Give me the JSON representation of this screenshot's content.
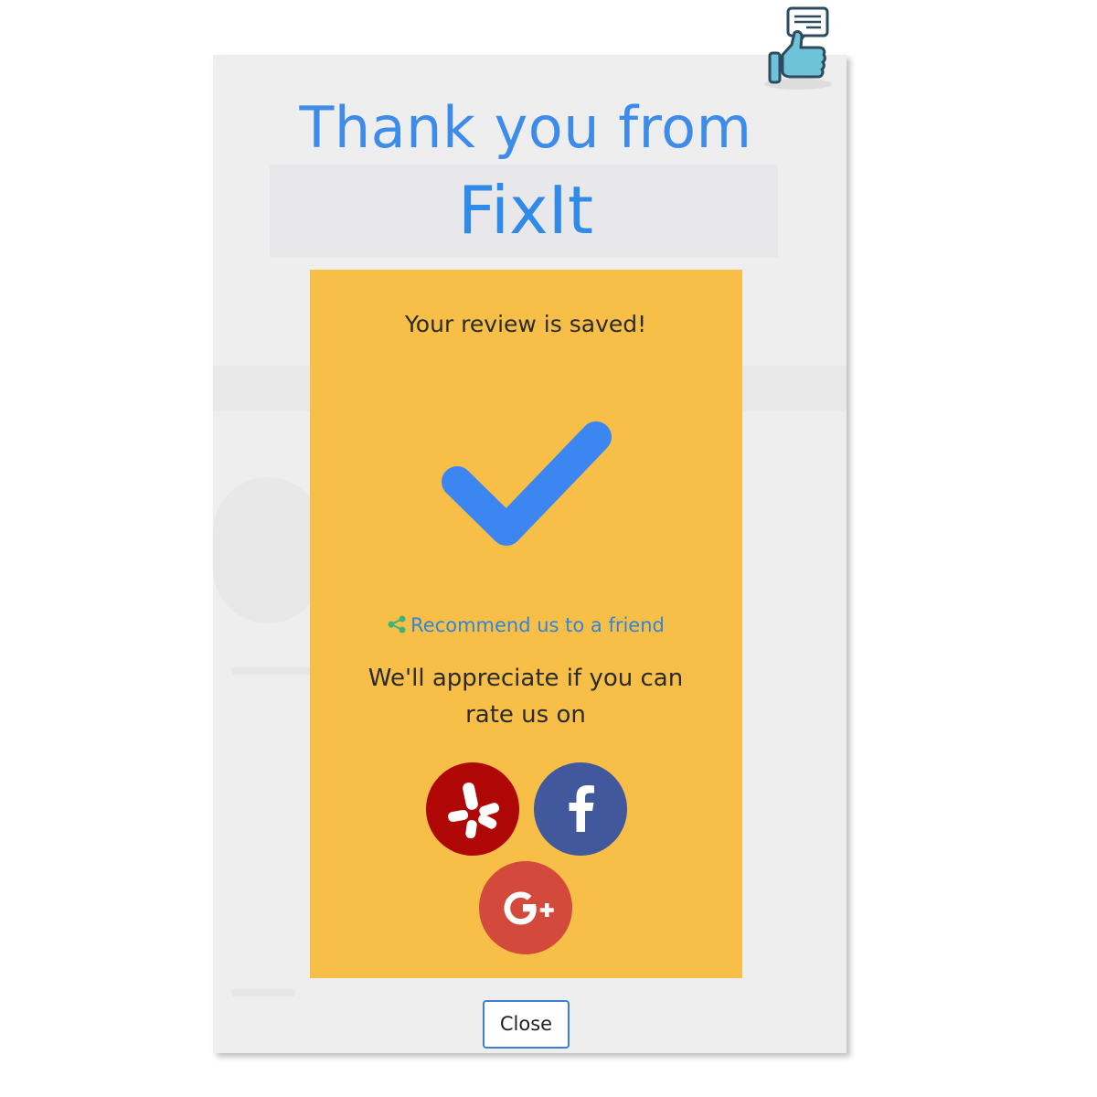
{
  "header": {
    "title_line_1": "Thank you from",
    "title_line_2": "FixIt"
  },
  "review_card": {
    "saved_message": "Your review is saved!",
    "recommend_link": "Recommend us to a friend",
    "appreciate_message": "We'll appreciate if you can rate us on",
    "social_buttons": [
      {
        "name": "yelp",
        "icon": "yelp-icon",
        "color": "#af0606"
      },
      {
        "name": "facebook",
        "icon": "facebook-icon",
        "color": "#42589c"
      },
      {
        "name": "google-plus",
        "icon": "google-plus-icon",
        "color": "#d34a3c"
      }
    ]
  },
  "footer": {
    "close_label": "Close"
  },
  "colors": {
    "title_blue": "#3d8bea",
    "card_yellow": "#f8bf48",
    "check_blue": "#3b86f0",
    "share_green": "#3cb37a",
    "link_blue": "#2f86d9"
  },
  "icons": {
    "corner": "thumbs-up-feedback-icon",
    "check": "checkmark-icon",
    "share": "share-icon"
  }
}
